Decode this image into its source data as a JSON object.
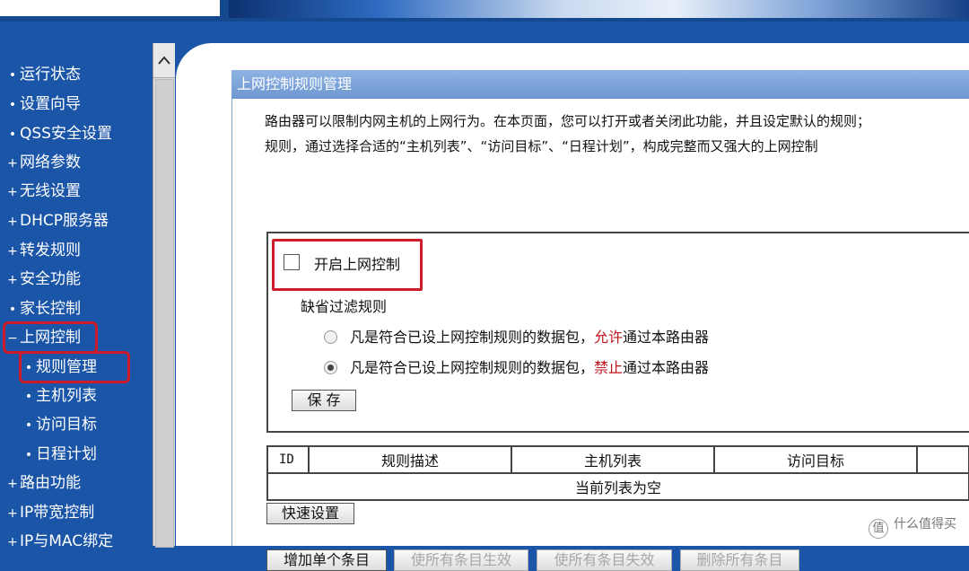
{
  "sidebar": {
    "items": [
      {
        "bullet": "•",
        "label": "运行状态"
      },
      {
        "bullet": "•",
        "label": "设置向导"
      },
      {
        "bullet": "•",
        "label": "QSS安全设置"
      },
      {
        "bullet": "+",
        "label": "网络参数"
      },
      {
        "bullet": "+",
        "label": "无线设置"
      },
      {
        "bullet": "+",
        "label": "DHCP服务器"
      },
      {
        "bullet": "+",
        "label": "转发规则"
      },
      {
        "bullet": "+",
        "label": "安全功能"
      },
      {
        "bullet": "•",
        "label": "家长控制"
      },
      {
        "bullet": "−",
        "label": "上网控制"
      },
      {
        "bullet": "•",
        "label": "规则管理"
      },
      {
        "bullet": "•",
        "label": "主机列表"
      },
      {
        "bullet": "•",
        "label": "访问目标"
      },
      {
        "bullet": "•",
        "label": "日程计划"
      },
      {
        "bullet": "+",
        "label": "路由功能"
      },
      {
        "bullet": "+",
        "label": "IP带宽控制"
      },
      {
        "bullet": "+",
        "label": "IP与MAC绑定"
      }
    ]
  },
  "panel": {
    "title": "上网控制规则管理",
    "desc_line1": "路由器可以限制内网主机的上网行为。在本页面，您可以打开或者关闭此功能，并且设定默认的规则；",
    "desc_line2": "规则，通过选择合适的“主机列表”、“访问目标”、“日程计划”，构成完整而又强大的上网控制"
  },
  "settings": {
    "enable_label": "开启上网控制",
    "default_rule_label": "缺省过滤规则",
    "allow_prefix": "凡是符合已设上网控制规则的数据包，",
    "allow_keyword": "允许",
    "allow_suffix": "通过本路由器",
    "deny_prefix": "凡是符合已设上网控制规则的数据包，",
    "deny_keyword": "禁止",
    "deny_suffix": "通过本路由器",
    "save_label": "保 存"
  },
  "table": {
    "headers": [
      "ID",
      "规则描述",
      "主机列表",
      "访问目标",
      ""
    ],
    "empty_text": "当前列表为空"
  },
  "buttons": {
    "quick_setup": "快速设置",
    "add_entry": "增加单个条目",
    "enable_all": "使所有条目生效",
    "disable_all": "使所有条目失效",
    "delete_all": "删除所有条目"
  },
  "watermark": {
    "icon_glyph": "值",
    "text": "什么值得买"
  }
}
